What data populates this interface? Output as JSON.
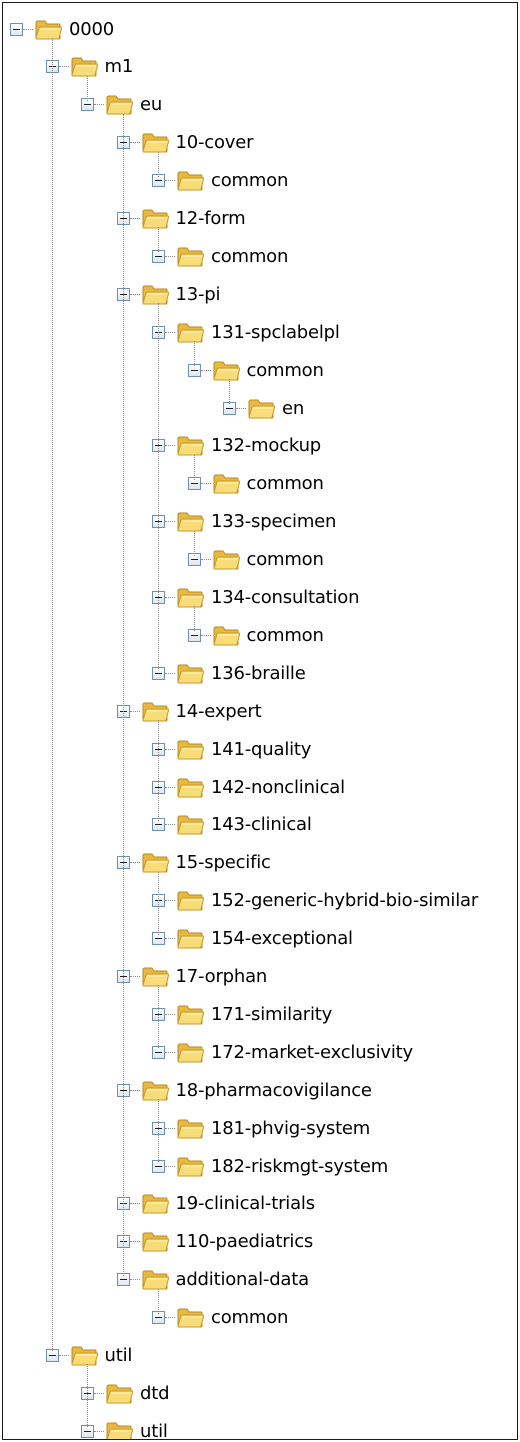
{
  "tree": [
    {
      "label": "0000",
      "level": 0,
      "icon": "folder-icon"
    },
    {
      "label": "m1",
      "level": 1,
      "icon": "folder-icon"
    },
    {
      "label": "eu",
      "level": 2,
      "icon": "folder-icon"
    },
    {
      "label": "10-cover",
      "level": 3,
      "icon": "folder-icon"
    },
    {
      "label": "common",
      "level": 4,
      "icon": "folder-icon"
    },
    {
      "label": "12-form",
      "level": 3,
      "icon": "folder-icon"
    },
    {
      "label": "common",
      "level": 4,
      "icon": "folder-icon"
    },
    {
      "label": "13-pi",
      "level": 3,
      "icon": "folder-icon"
    },
    {
      "label": "131-spclabelpl",
      "level": 4,
      "icon": "folder-icon"
    },
    {
      "label": "common",
      "level": 5,
      "icon": "folder-icon"
    },
    {
      "label": "en",
      "level": 6,
      "icon": "folder-icon"
    },
    {
      "label": "132-mockup",
      "level": 4,
      "icon": "folder-icon"
    },
    {
      "label": "common",
      "level": 5,
      "icon": "folder-icon"
    },
    {
      "label": "133-specimen",
      "level": 4,
      "icon": "folder-icon"
    },
    {
      "label": "common",
      "level": 5,
      "icon": "folder-icon"
    },
    {
      "label": "134-consultation",
      "level": 4,
      "icon": "folder-icon"
    },
    {
      "label": "common",
      "level": 5,
      "icon": "folder-icon"
    },
    {
      "label": "136-braille",
      "level": 4,
      "icon": "folder-icon"
    },
    {
      "label": "14-expert",
      "level": 3,
      "icon": "folder-icon"
    },
    {
      "label": "141-quality",
      "level": 4,
      "icon": "folder-icon"
    },
    {
      "label": "142-nonclinical",
      "level": 4,
      "icon": "folder-icon"
    },
    {
      "label": "143-clinical",
      "level": 4,
      "icon": "folder-icon"
    },
    {
      "label": "15-specific",
      "level": 3,
      "icon": "folder-icon"
    },
    {
      "label": "152-generic-hybrid-bio-similar",
      "level": 4,
      "icon": "folder-icon"
    },
    {
      "label": "154-exceptional",
      "level": 4,
      "icon": "folder-icon"
    },
    {
      "label": "17-orphan",
      "level": 3,
      "icon": "folder-icon"
    },
    {
      "label": "171-similarity",
      "level": 4,
      "icon": "folder-icon"
    },
    {
      "label": "172-market-exclusivity",
      "level": 4,
      "icon": "folder-icon"
    },
    {
      "label": "18-pharmacovigilance",
      "level": 3,
      "icon": "folder-icon"
    },
    {
      "label": "181-phvig-system",
      "level": 4,
      "icon": "folder-icon"
    },
    {
      "label": "182-riskmgt-system",
      "level": 4,
      "icon": "folder-icon"
    },
    {
      "label": "19-clinical-trials",
      "level": 3,
      "icon": "folder-icon"
    },
    {
      "label": "110-paediatrics",
      "level": 3,
      "icon": "folder-icon"
    },
    {
      "label": "additional-data",
      "level": 3,
      "icon": "folder-icon"
    },
    {
      "label": "common",
      "level": 4,
      "icon": "folder-icon"
    },
    {
      "label": "util",
      "level": 1,
      "icon": "folder-icon"
    },
    {
      "label": "dtd",
      "level": 2,
      "icon": "folder-icon"
    },
    {
      "label": "util",
      "level": 2,
      "icon": "folder-icon"
    }
  ],
  "colors": {
    "folder_fill": "#f6d66a",
    "folder_edge": "#c79a2c",
    "toggle_border": "#6d8fb0",
    "connector": "#8a8a8a"
  }
}
